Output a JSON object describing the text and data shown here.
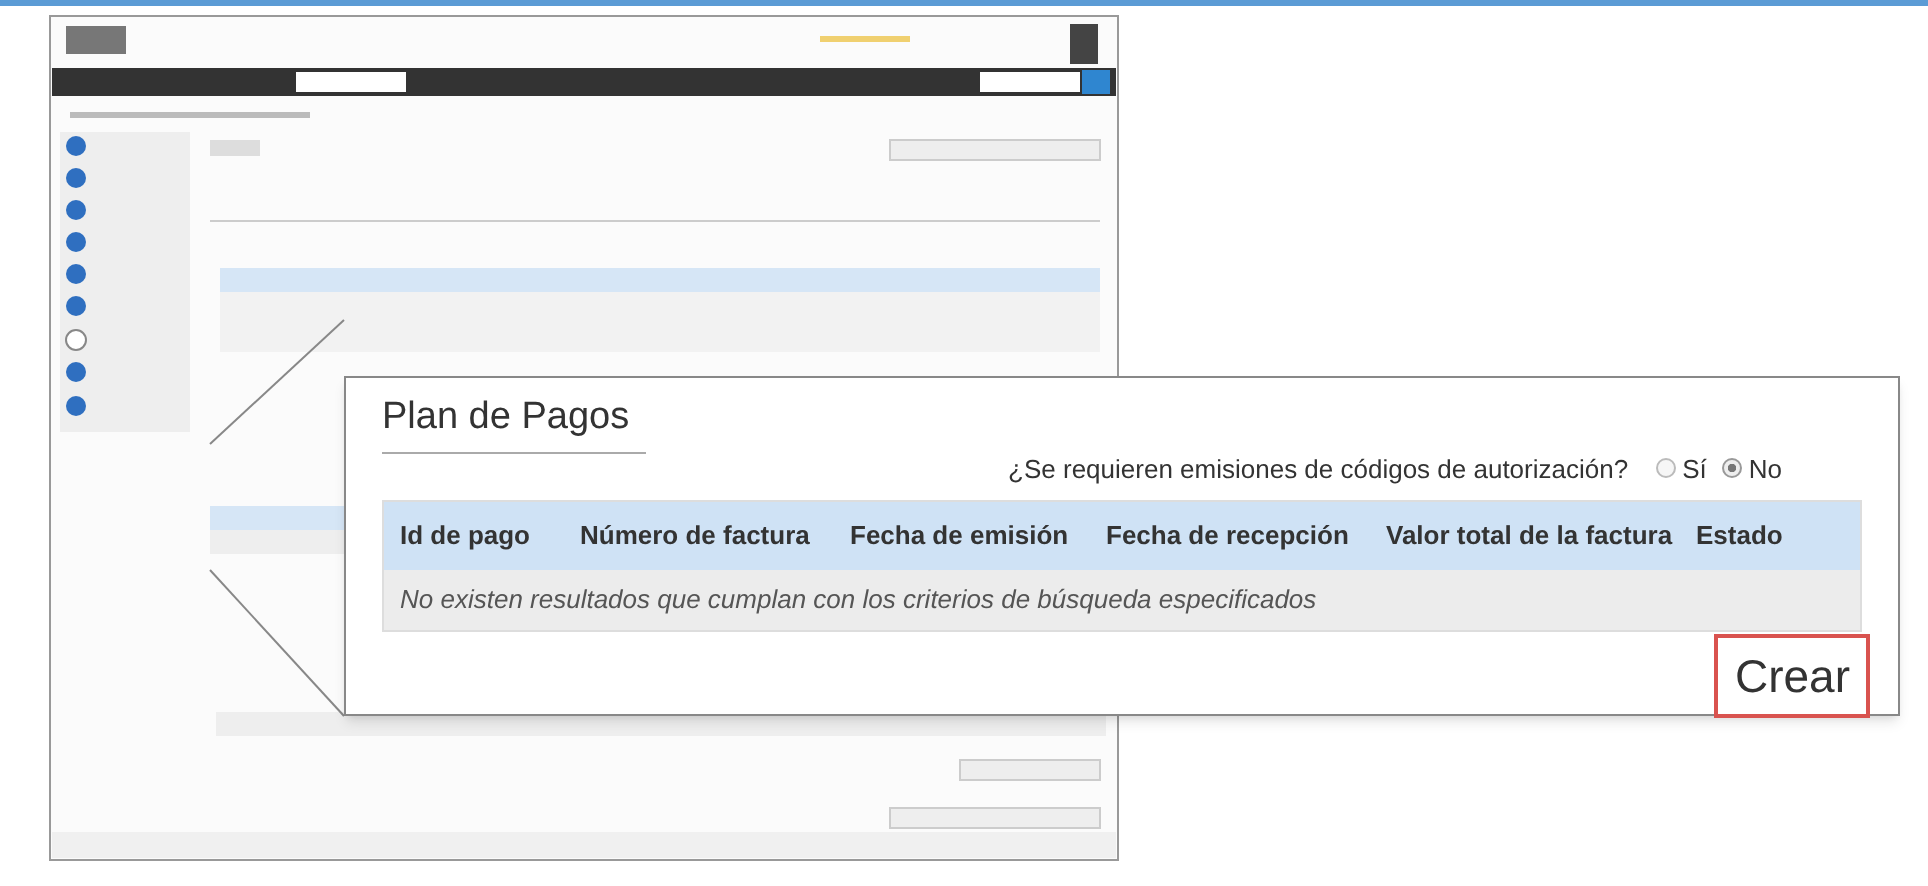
{
  "callout": {
    "title": "Plan de Pagos",
    "question": "¿Se requieren emisiones de códigos de autorización?",
    "options": [
      {
        "label": "Sí",
        "selected": false
      },
      {
        "label": "No",
        "selected": true
      }
    ],
    "columns": [
      "Id de pago",
      "Número de factura",
      "Fecha de emisión",
      "Fecha de recepción",
      "Valor total de la factura",
      "Estado"
    ],
    "empty_message": "No existen resultados que cumplan con los criterios de búsqueda especificados",
    "button": "Crear"
  }
}
